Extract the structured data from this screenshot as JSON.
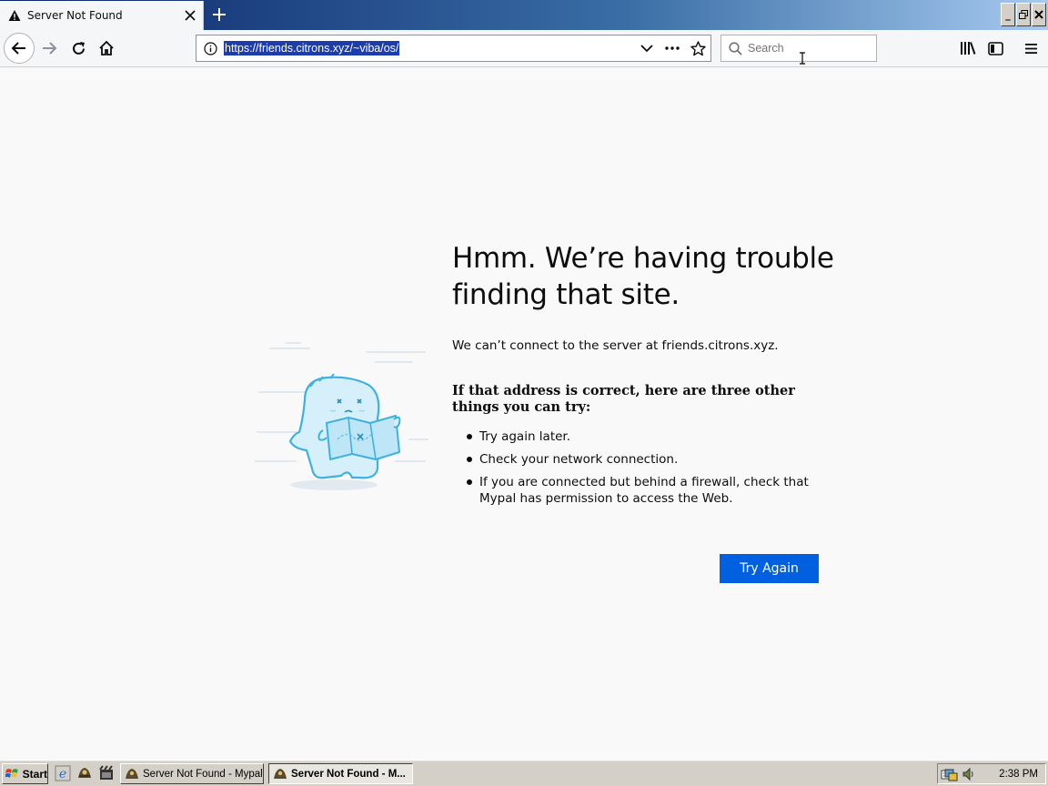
{
  "browser": {
    "tab": {
      "title": "Server Not Found"
    },
    "window_controls": {
      "minimize": "_",
      "restore": "🗗",
      "close": "✕"
    },
    "url": "https://friends.citrons.xyz/~viba/os/",
    "search": {
      "placeholder": "Search"
    },
    "icons": [
      "back-icon",
      "forward-icon",
      "reload-icon",
      "home-icon",
      "info-icon",
      "chevron-down-icon",
      "page-actions-icon",
      "bookmark-star-icon",
      "search-icon",
      "library-icon",
      "sidebar-icon",
      "menu-icon"
    ]
  },
  "error_page": {
    "title": "Hmm. We’re having trouble finding that site.",
    "short_desc": "We can’t connect to the server at friends.citrons.xyz.",
    "suggest_heading": "If that address is correct, here are three other things you can try:",
    "suggestions": [
      "Try again later.",
      "Check your network connection.",
      "If you are connected but behind a firewall, check that Mypal has permission to access the Web."
    ],
    "button_label": "Try Again",
    "accent_color": "#0060df"
  },
  "taskbar": {
    "start_label": "Start",
    "tasks": [
      {
        "label": "Server Not Found - Mypal",
        "active": false
      },
      {
        "label": "Server Not Found - M...",
        "active": true
      }
    ],
    "clock": "2:38 PM"
  }
}
